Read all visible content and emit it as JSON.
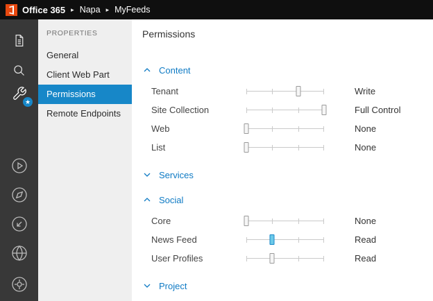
{
  "topbar": {
    "brand": "Office 365",
    "separator": "▸",
    "breadcrumb": [
      "Napa",
      "MyFeeds"
    ]
  },
  "sidebar": {
    "icons": [
      "projects-icon",
      "search-icon",
      "properties-wrench-icon",
      "run-play-icon",
      "compass-icon",
      "retract-arrow-icon",
      "globe-icon",
      "settings-icon"
    ],
    "badge_glyph": "★"
  },
  "menu": {
    "header": "PROPERTIES",
    "items": [
      {
        "label": "General",
        "selected": false
      },
      {
        "label": "Client Web Part",
        "selected": false
      },
      {
        "label": "Permissions",
        "selected": true
      },
      {
        "label": "Remote Endpoints",
        "selected": false
      }
    ]
  },
  "main": {
    "title": "Permissions",
    "permission_levels": [
      "None",
      "Read",
      "Write",
      "Full Control"
    ],
    "sections": [
      {
        "label": "Content",
        "expanded": true,
        "rows": [
          {
            "label": "Tenant",
            "value": "Write",
            "position": 66.7,
            "active": false
          },
          {
            "label": "Site Collection",
            "value": "Full Control",
            "position": 100,
            "active": false
          },
          {
            "label": "Web",
            "value": "None",
            "position": 0,
            "active": false
          },
          {
            "label": "List",
            "value": "None",
            "position": 0,
            "active": false
          }
        ]
      },
      {
        "label": "Services",
        "expanded": false,
        "rows": []
      },
      {
        "label": "Social",
        "expanded": true,
        "rows": [
          {
            "label": "Core",
            "value": "None",
            "position": 0,
            "active": false
          },
          {
            "label": "News Feed",
            "value": "Read",
            "position": 33.3,
            "active": true
          },
          {
            "label": "User Profiles",
            "value": "Read",
            "position": 33.3,
            "active": false
          }
        ]
      },
      {
        "label": "Project",
        "expanded": false,
        "rows": []
      }
    ]
  },
  "colors": {
    "accent_blue": "#1787c8",
    "section_blue": "#0e7ac4",
    "logo_orange": "#e8480f",
    "slider_active_fill": "#6cc9e8",
    "topbar_bg": "#0f0f0f",
    "iconbar_bg": "#383838",
    "menu_bg": "#efefef"
  }
}
